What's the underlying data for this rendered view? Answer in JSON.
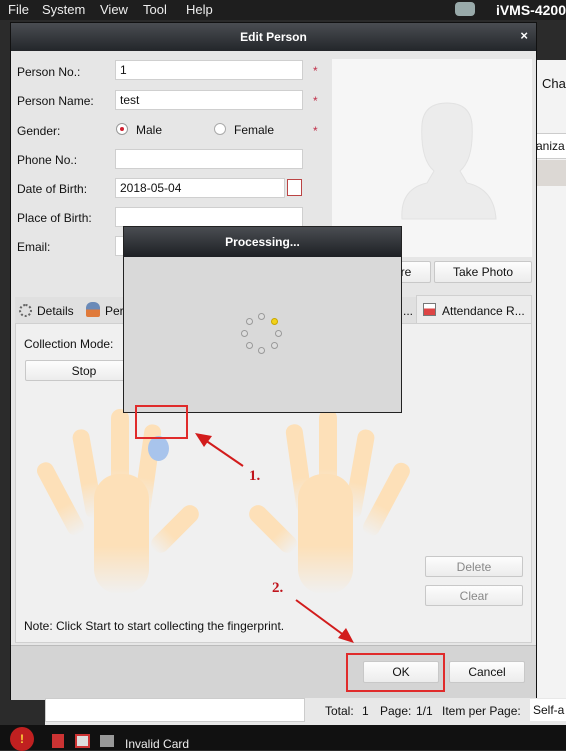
{
  "menubar": {
    "items": [
      "File",
      "System",
      "View",
      "Tool",
      "Help"
    ],
    "brand": "iVMS-4200"
  },
  "background": {
    "tab_partial": "Cha",
    "org_partial": "aniza"
  },
  "dialog": {
    "title": "Edit Person",
    "close": "×",
    "fields": {
      "person_no": {
        "label": "Person No.:",
        "value": "1",
        "required": "*"
      },
      "person_name": {
        "label": "Person Name:",
        "value": "test",
        "required": "*"
      },
      "gender": {
        "label": "Gender:",
        "options": [
          "Male",
          "Female"
        ],
        "selected": "Male",
        "required": "*"
      },
      "phone": {
        "label": "Phone No.:",
        "value": ""
      },
      "dob": {
        "label": "Date of Birth:",
        "value": "2018-05-04"
      },
      "pob": {
        "label": "Place of Birth:",
        "value": ""
      },
      "email": {
        "label": "Email:",
        "value": ""
      }
    },
    "photo_buttons": {
      "capture": "ture",
      "take_photo": "Take Photo"
    },
    "tabs": {
      "details": "Details",
      "permission": "Per",
      "ellipsis": "...",
      "attendance": "Attendance R..."
    },
    "fingerprint": {
      "collection_mode_label": "Collection Mode:",
      "stop": "Stop",
      "delete": "Delete",
      "clear": "Clear",
      "note": "Note: Click Start to start collecting the fingerprint."
    },
    "ok": "OK",
    "cancel": "Cancel"
  },
  "processing": {
    "title": "Processing..."
  },
  "annotations": {
    "step1": "1.",
    "step2": "2.",
    "color": "#e02b2b"
  },
  "pager": {
    "total_label": "Total:",
    "total": "1",
    "page_label": "Page:",
    "page": "1/1",
    "per_page_label": "Item per Page:",
    "per_page": "Self-a"
  },
  "taskbar": {
    "status": "Invalid Card"
  },
  "colors": {
    "accent_red": "#c0304a",
    "finger_selected": "#a8c4ec",
    "hand": "#fde0b8"
  }
}
